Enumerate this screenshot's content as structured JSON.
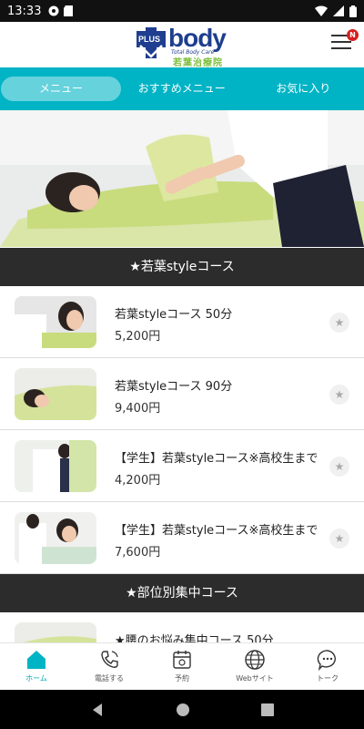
{
  "status": {
    "time": "13:33"
  },
  "header": {
    "logo_plus": "PLUS",
    "logo_word": "body",
    "logo_sub": "Total Body Care",
    "logo_jp": "若葉治療院",
    "menu_badge": "N"
  },
  "tabs": [
    {
      "label": "メニュー",
      "active": true
    },
    {
      "label": "おすすめメニュー",
      "active": false
    },
    {
      "label": "お気に入り",
      "active": false
    }
  ],
  "sections": [
    {
      "title": "★若葉styleコース",
      "items": [
        {
          "name": "若葉styleコース 50分",
          "price": "5,200円"
        },
        {
          "name": "若葉styleコース 90分",
          "price": "9,400円"
        },
        {
          "name": "【学生】若葉styleコース※高校生まで",
          "price": "4,200円"
        },
        {
          "name": "【学生】若葉styleコース※高校生まで",
          "price": "7,600円"
        }
      ]
    },
    {
      "title": "★部位別集中コース",
      "items": [
        {
          "name": "★腰のお悩み集中コース 50分",
          "price": ""
        }
      ]
    }
  ],
  "bottom_nav": [
    {
      "label": "ホーム",
      "icon": "home-icon",
      "active": true
    },
    {
      "label": "電話する",
      "icon": "phone-icon",
      "active": false
    },
    {
      "label": "予約",
      "icon": "calendar-icon",
      "active": false
    },
    {
      "label": "Webサイト",
      "icon": "globe-icon",
      "active": false
    },
    {
      "label": "トーク",
      "icon": "chat-icon",
      "active": false
    }
  ],
  "colors": {
    "accent": "#00b4c5",
    "section_bg": "#2c2c2c",
    "brand_blue": "#1f3e8f",
    "brand_green": "#7bbf3a"
  }
}
